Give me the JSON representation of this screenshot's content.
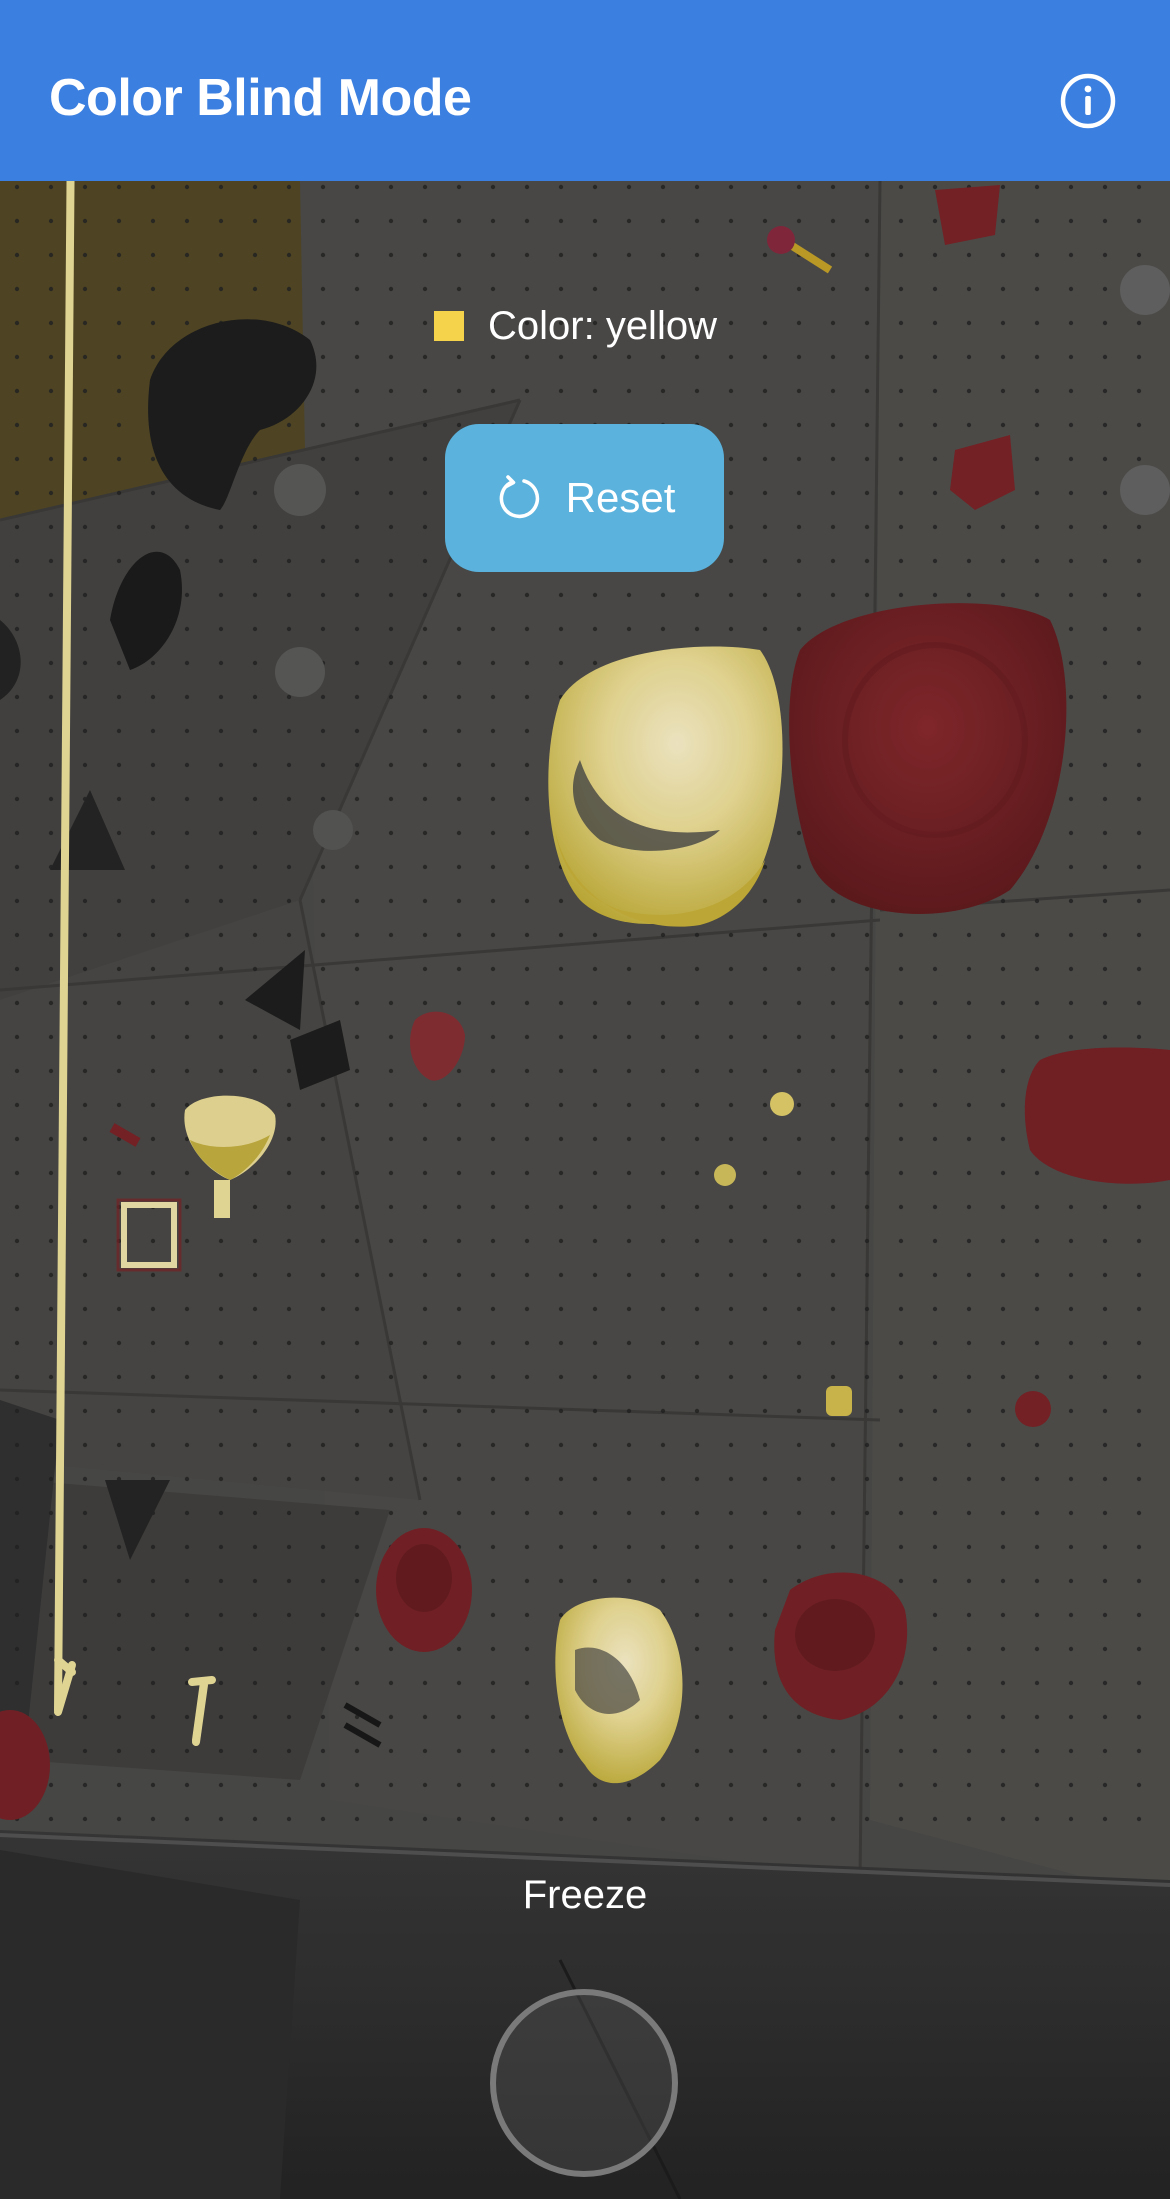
{
  "header": {
    "title": "Color Blind Mode",
    "info_icon": "info-circle-icon",
    "background": "#3b7fe0"
  },
  "detection": {
    "label": "Color: yellow",
    "swatch_color": "#f5d34a"
  },
  "reset": {
    "label": "Reset",
    "icon": "refresh-icon",
    "background": "#5ab2dd"
  },
  "freeze": {
    "label": "Freeze"
  },
  "highlight_color": "#f0dc6a",
  "hold_color": "#7d2428"
}
